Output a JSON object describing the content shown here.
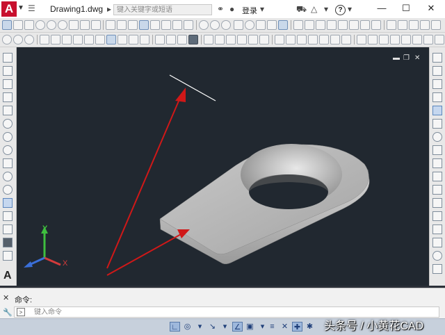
{
  "app": {
    "logo_letter": "A",
    "document_title": "Drawing1.dwg"
  },
  "search": {
    "placeholder": "键入关键字或短语"
  },
  "account": {
    "login_label": "登录"
  },
  "help": {
    "label": "?"
  },
  "window_controls": {
    "minimize": "—",
    "maximize": "☐",
    "close": "✕"
  },
  "viewport_controls": {
    "minimize": "▬",
    "restore": "❐",
    "close": "✕"
  },
  "ucs": {
    "x_label": "X",
    "y_label": "Y",
    "x_color": "#d43b3b",
    "y_color": "#3fbf3f",
    "z_color": "#3a6fd8"
  },
  "command": {
    "label": "命令:",
    "placeholder": "键入命令"
  },
  "status_icons": [
    "grid-icon",
    "snap-icon",
    "ortho-icon",
    "polar-icon",
    "osnap-icon",
    "otrack-icon",
    "lineweight-icon",
    "transparency-icon",
    "selection-cycling-icon",
    "annotation-icon",
    "workspace-icon",
    "customization-icon"
  ],
  "watermark": {
    "text": "头条号 / 小黄花CAD"
  },
  "colors": {
    "viewport_background": "#212830",
    "arrow": "#d01818",
    "model_face": "#b6b6b6",
    "app_logo": "#c8102e"
  }
}
